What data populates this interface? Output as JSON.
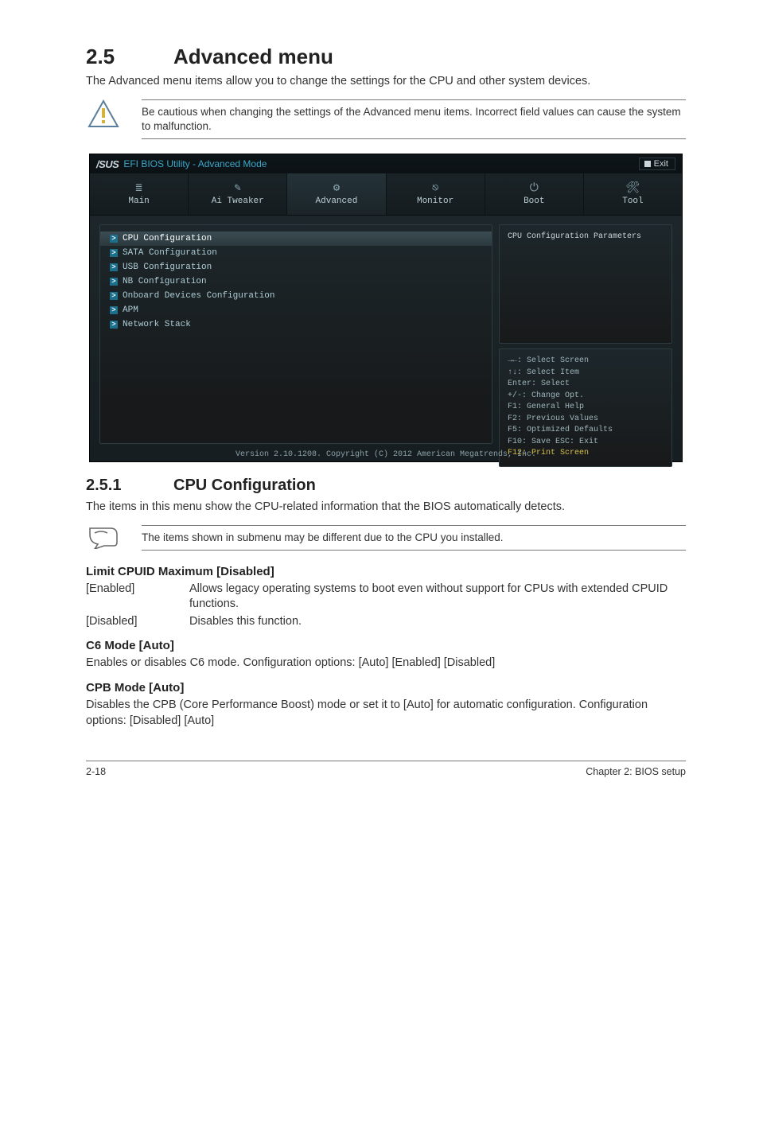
{
  "section": {
    "num": "2.5",
    "title": "Advanced menu"
  },
  "intro": "The Advanced menu items allow you to change the settings for the CPU and other system devices.",
  "caution": "Be cautious when changing the settings of the Advanced menu items. Incorrect field values can cause the system to malfunction.",
  "bios": {
    "brand": "/SUS",
    "title": "EFI BIOS Utility - Advanced Mode",
    "exit": "Exit",
    "tabs": [
      {
        "icon": "≣",
        "label": "Main"
      },
      {
        "icon": "✎",
        "label": "Ai Tweaker"
      },
      {
        "icon": "⚙",
        "label": "Advanced"
      },
      {
        "icon": "⎋",
        "label": "Monitor"
      },
      {
        "icon": "⏻",
        "label": "Boot"
      },
      {
        "icon": "🛠",
        "label": "Tool"
      }
    ],
    "active_tab": 2,
    "menu": [
      "CPU Configuration",
      "SATA Configuration",
      "USB Configuration",
      "NB Configuration",
      "Onboard Devices Configuration",
      "APM",
      "Network Stack"
    ],
    "selected_index": 0,
    "right_top": "CPU Configuration Parameters",
    "help": [
      "→←: Select Screen",
      "↑↓: Select Item",
      "Enter: Select",
      "+/-: Change Opt.",
      "F1: General Help",
      "F2: Previous Values",
      "F5: Optimized Defaults",
      "F10: Save  ESC: Exit",
      "F12: Print Screen"
    ],
    "footer": "Version 2.10.1208. Copyright (C) 2012 American Megatrends, Inc."
  },
  "sub": {
    "num": "2.5.1",
    "title": "CPU Configuration"
  },
  "sub_intro": "The items in this menu show the CPU-related information that the BIOS automatically detects.",
  "note": "The items shown in submenu may be different due to the CPU you installed.",
  "limit": {
    "heading": "Limit CPUID Maximum [Disabled]",
    "rows": [
      {
        "label": "[Enabled]",
        "desc": "Allows legacy operating systems to boot even without support for CPUs with extended CPUID functions."
      },
      {
        "label": "[Disabled]",
        "desc": "Disables this function."
      }
    ]
  },
  "c6": {
    "heading": "C6 Mode [Auto]",
    "body": "Enables or disables C6 mode. Configuration options: [Auto] [Enabled] [Disabled]"
  },
  "cpb": {
    "heading": "CPB Mode [Auto]",
    "body": "Disables the CPB (Core Performance Boost) mode or set it to [Auto] for automatic configuration. Configuration options: [Disabled] [Auto]"
  },
  "footer": {
    "left": "2-18",
    "right": "Chapter 2: BIOS setup"
  }
}
